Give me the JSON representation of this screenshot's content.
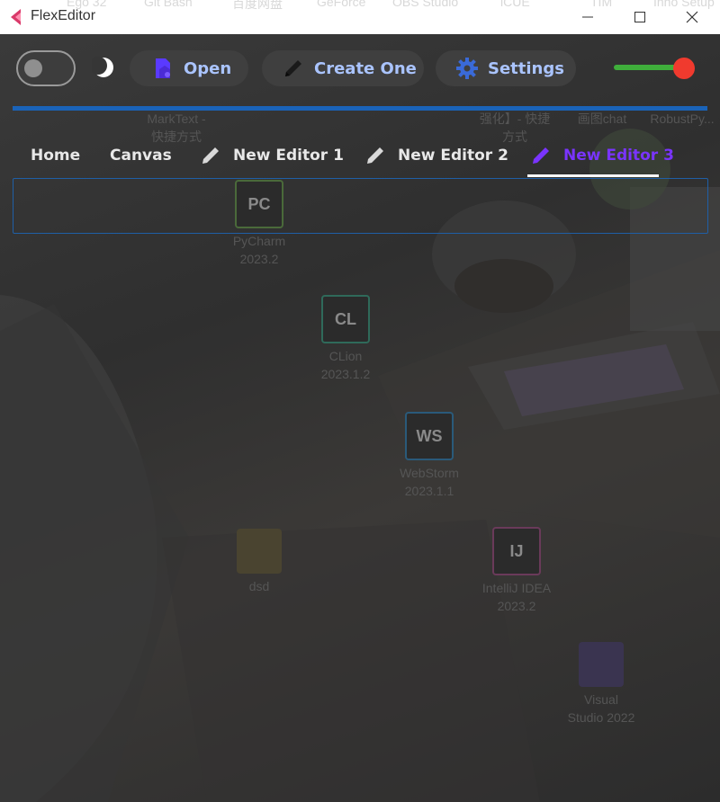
{
  "window": {
    "title": "FlexEditor",
    "behind_titles": [
      "Ego 32",
      "Git Bash",
      "百度网盘",
      "GeForce",
      "OBS Studio",
      "iCUE",
      "TIM",
      "Inno Setup"
    ]
  },
  "toolbar": {
    "theme_toggle_on": false,
    "open_label": "Open",
    "create_label": "Create One",
    "settings_label": "Settings",
    "slider_value": 1.0
  },
  "tabs": [
    {
      "label": "Home",
      "icon": "none",
      "active": false
    },
    {
      "label": "Canvas",
      "icon": "none",
      "active": false
    },
    {
      "label": "New Editor 1",
      "icon": "pencil-icon",
      "active": false
    },
    {
      "label": "New Editor 2",
      "icon": "pencil-icon",
      "active": false
    },
    {
      "label": "New Editor 3",
      "icon": "pencil-icon",
      "active": true
    }
  ],
  "desktop": {
    "icons": [
      {
        "name": "PyCharm",
        "line2": "2023.2",
        "abbr": "PC"
      },
      {
        "name": "CLion",
        "line2": "2023.1.2",
        "abbr": "CL"
      },
      {
        "name": "WebStorm",
        "line2": "2023.1.1",
        "abbr": "WS"
      },
      {
        "name": "dsd",
        "line2": "",
        "abbr": ""
      },
      {
        "name": "IntelliJ IDEA",
        "line2": "2023.2",
        "abbr": "IJ"
      },
      {
        "name": "Visual",
        "line2": "Studio 2022",
        "abbr": ""
      },
      {
        "name": "MarkText -",
        "line2": "快捷方式",
        "abbr": ""
      },
      {
        "name": "强化】- 快捷",
        "line2": "方式",
        "abbr": ""
      },
      {
        "name": "画图chat",
        "line2": "",
        "abbr": ""
      },
      {
        "name": "RobustPy...",
        "line2": "",
        "abbr": ""
      }
    ]
  },
  "colors": {
    "accent_blue": "#1a63b8",
    "active_tab": "#7a34ff",
    "button_text": "#aac4ff",
    "slider_green": "#3fae3b",
    "slider_red": "#f03a2e"
  }
}
